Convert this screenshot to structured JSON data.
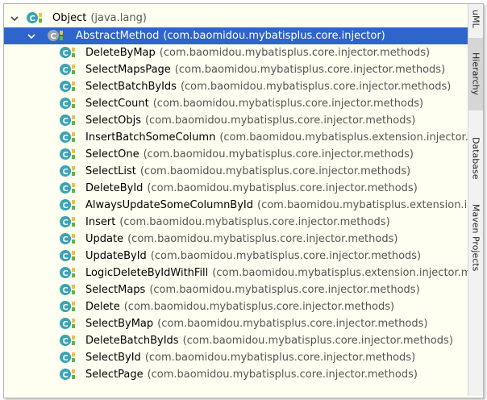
{
  "hierarchy": {
    "root": {
      "name": "Object",
      "package": "(java.lang)"
    },
    "selected": {
      "name": "AbstractMethod",
      "package": "(com.baomidou.mybatisplus.core.injector)"
    },
    "children": [
      {
        "name": "DeleteByMap",
        "package": "(com.baomidou.mybatisplus.core.injector.methods)"
      },
      {
        "name": "SelectMapsPage",
        "package": "(com.baomidou.mybatisplus.core.injector.methods)"
      },
      {
        "name": "SelectBatchByIds",
        "package": "(com.baomidou.mybatisplus.core.injector.methods)"
      },
      {
        "name": "SelectCount",
        "package": "(com.baomidou.mybatisplus.core.injector.methods)"
      },
      {
        "name": "SelectObjs",
        "package": "(com.baomidou.mybatisplus.core.injector.methods)"
      },
      {
        "name": "InsertBatchSomeColumn",
        "package": "(com.baomidou.mybatisplus.extension.injector.methods.a"
      },
      {
        "name": "SelectOne",
        "package": "(com.baomidou.mybatisplus.core.injector.methods)"
      },
      {
        "name": "SelectList",
        "package": "(com.baomidou.mybatisplus.core.injector.methods)"
      },
      {
        "name": "DeleteById",
        "package": "(com.baomidou.mybatisplus.core.injector.methods)"
      },
      {
        "name": "AlwaysUpdateSomeColumnById",
        "package": "(com.baomidou.mybatisplus.extension.injector.me"
      },
      {
        "name": "Insert",
        "package": "(com.baomidou.mybatisplus.core.injector.methods)"
      },
      {
        "name": "Update",
        "package": "(com.baomidou.mybatisplus.core.injector.methods)"
      },
      {
        "name": "UpdateById",
        "package": "(com.baomidou.mybatisplus.core.injector.methods)"
      },
      {
        "name": "LogicDeleteByIdWithFill",
        "package": "(com.baomidou.mybatisplus.extension.injector.methods.ad"
      },
      {
        "name": "SelectMaps",
        "package": "(com.baomidou.mybatisplus.core.injector.methods)"
      },
      {
        "name": "Delete",
        "package": "(com.baomidou.mybatisplus.core.injector.methods)"
      },
      {
        "name": "SelectByMap",
        "package": "(com.baomidou.mybatisplus.core.injector.methods)"
      },
      {
        "name": "DeleteBatchByIds",
        "package": "(com.baomidou.mybatisplus.core.injector.methods)"
      },
      {
        "name": "SelectById",
        "package": "(com.baomidou.mybatisplus.core.injector.methods)"
      },
      {
        "name": "SelectPage",
        "package": "(com.baomidou.mybatisplus.core.injector.methods)"
      }
    ]
  },
  "side_tabs": [
    {
      "label": "uML"
    },
    {
      "label": "Hierarchy"
    },
    {
      "label": "Database"
    },
    {
      "label": "Maven Projects"
    }
  ],
  "icons": {
    "class_icon": "class-c-icon",
    "abstract_icon": "abstract-class-icon",
    "expand_icon": "chevron-down-icon"
  },
  "colors": {
    "selection": "#2f65ca",
    "background": "#fffff1",
    "class_icon": "#3aa3b4",
    "package_text": "#555555"
  }
}
